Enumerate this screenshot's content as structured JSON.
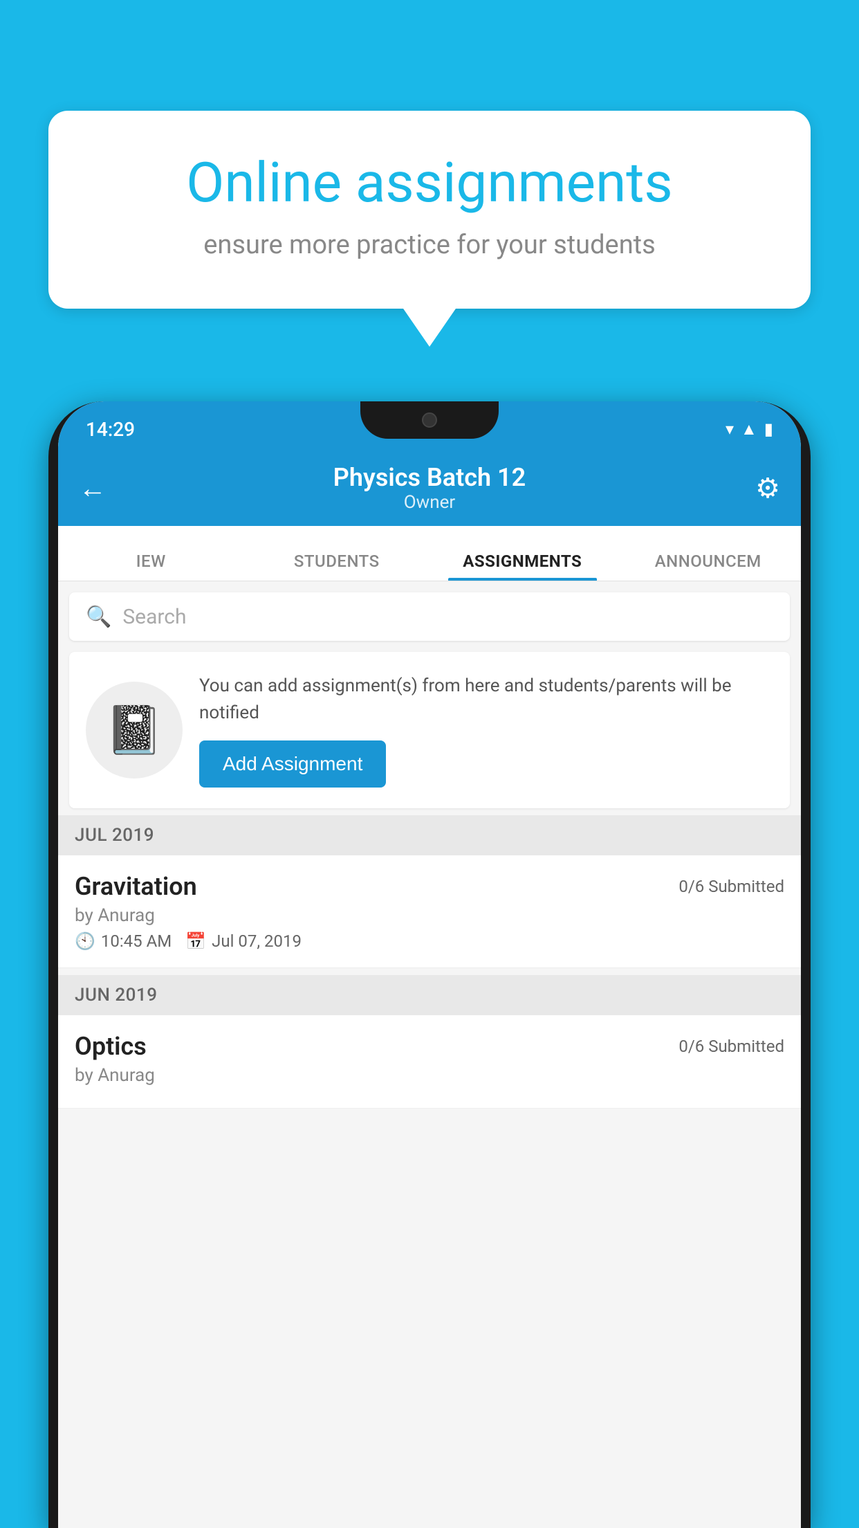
{
  "background_color": "#1ab8e8",
  "speech_bubble": {
    "title": "Online assignments",
    "subtitle": "ensure more practice for your students"
  },
  "status_bar": {
    "time": "14:29",
    "icons": [
      "wifi",
      "signal",
      "battery"
    ]
  },
  "header": {
    "title": "Physics Batch 12",
    "subtitle": "Owner",
    "back_label": "←",
    "settings_label": "⚙"
  },
  "tabs": [
    {
      "label": "IEW",
      "active": false
    },
    {
      "label": "STUDENTS",
      "active": false
    },
    {
      "label": "ASSIGNMENTS",
      "active": true
    },
    {
      "label": "ANNOUNCEM",
      "active": false
    }
  ],
  "search": {
    "placeholder": "Search"
  },
  "empty_state": {
    "description": "You can add assignment(s) from here and students/parents will be notified",
    "button_label": "Add Assignment"
  },
  "sections": [
    {
      "month": "JUL 2019",
      "assignments": [
        {
          "name": "Gravitation",
          "submitted": "0/6 Submitted",
          "by": "by Anurag",
          "time": "10:45 AM",
          "date": "Jul 07, 2019"
        }
      ]
    },
    {
      "month": "JUN 2019",
      "assignments": [
        {
          "name": "Optics",
          "submitted": "0/6 Submitted",
          "by": "by Anurag",
          "time": "",
          "date": ""
        }
      ]
    }
  ]
}
